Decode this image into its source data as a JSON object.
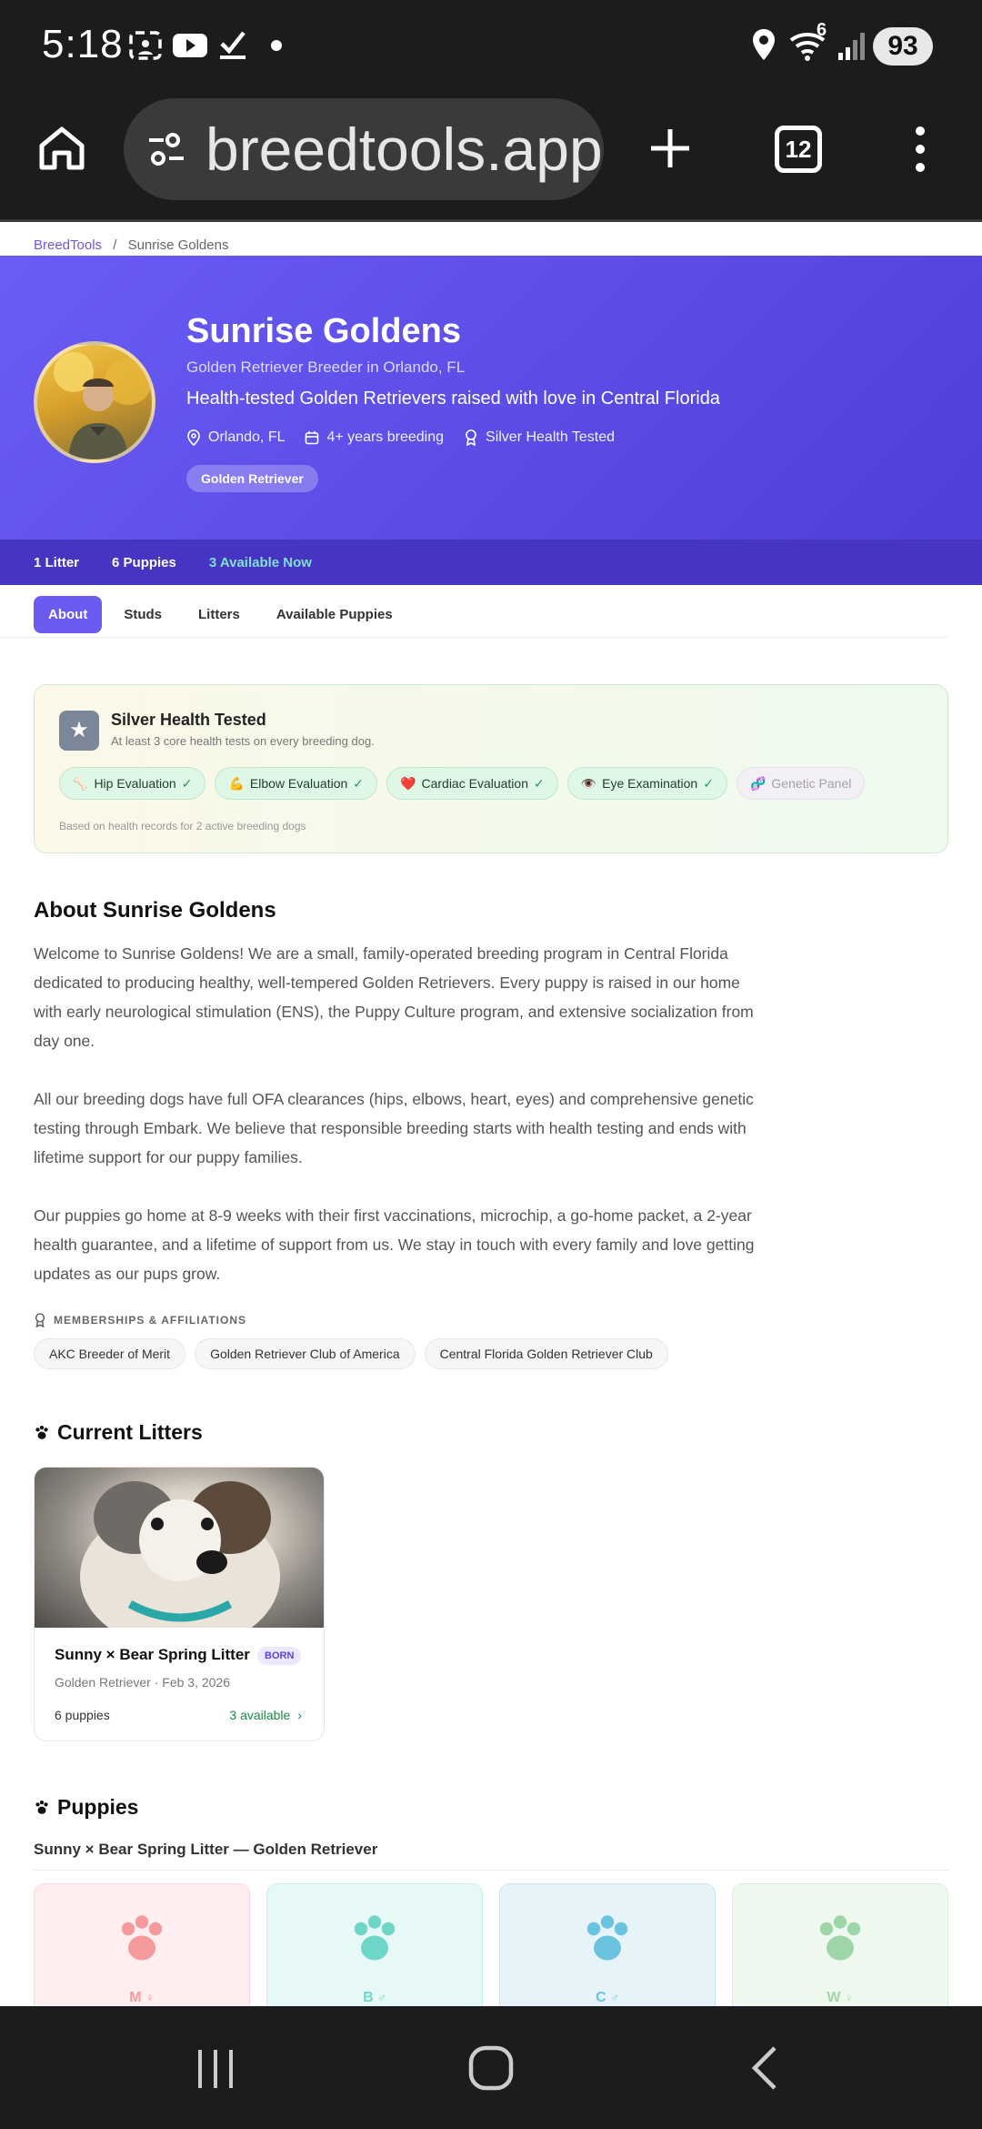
{
  "status": {
    "time": "5:18",
    "battery": "93",
    "signal_sup": "6"
  },
  "browser": {
    "url": "breedtools.app/",
    "tab_count": "12"
  },
  "breadcrumb": {
    "home": "BreedTools",
    "sep": "/",
    "current": "Sunrise Goldens"
  },
  "hero": {
    "title": "Sunrise Goldens",
    "subtitle": "Golden Retriever Breeder in Orlando, FL",
    "tagline": "Health-tested Golden Retrievers raised with love in Central Florida",
    "location": "Orlando, FL",
    "experience": "4+ years breeding",
    "health": "Silver Health Tested",
    "breed_badge": "Golden Retriever"
  },
  "stats": {
    "litters": "1 Litter",
    "puppies": "6 Puppies",
    "available": "3 Available Now"
  },
  "tabs": [
    "About",
    "Studs",
    "Litters",
    "Available Puppies"
  ],
  "health_card": {
    "title": "Silver Health Tested",
    "subtitle": "At least 3 core health tests on every breeding dog.",
    "chips": [
      {
        "emoji": "🦴",
        "label": "Hip Evaluation",
        "done": true
      },
      {
        "emoji": "💪",
        "label": "Elbow Evaluation",
        "done": true
      },
      {
        "emoji": "❤️",
        "label": "Cardiac Evaluation",
        "done": true
      },
      {
        "emoji": "👁️",
        "label": "Eye Examination",
        "done": true
      },
      {
        "emoji": "🧬",
        "label": "Genetic Panel",
        "done": false
      }
    ],
    "note": "Based on health records for 2 active breeding dogs"
  },
  "about": {
    "title": "About Sunrise Goldens",
    "p1": "Welcome to Sunrise Goldens! We are a small, family-operated breeding program in Central Florida dedicated to producing healthy, well-tempered Golden Retrievers. Every puppy is raised in our home with early neurological stimulation (ENS), the Puppy Culture program, and extensive socialization from day one.",
    "p2": "All our breeding dogs have full OFA clearances (hips, elbows, heart, eyes) and comprehensive genetic testing through Embark. We believe that responsible breeding starts with health testing and ends with lifetime support for our puppy families.",
    "p3": "Our puppies go home at 8-9 weeks with their first vaccinations, microchip, a go-home packet, a 2-year health guarantee, and a lifetime of support from us. We stay in touch with every family and love getting updates as our pups grow."
  },
  "memberships": {
    "label": "MEMBERSHIPS & AFFILIATIONS",
    "items": [
      "AKC Breeder of Merit",
      "Golden Retriever Club of America",
      "Central Florida Golden Retriever Club"
    ]
  },
  "litters": {
    "title": "Current Litters",
    "card": {
      "name": "Sunny × Bear Spring Litter",
      "badge": "BORN",
      "meta": "Golden Retriever · Feb 3, 2026",
      "count": "6 puppies",
      "available": "3 available"
    }
  },
  "puppies": {
    "title": "Puppies",
    "subtitle": "Sunny × Bear Spring Litter — Golden Retriever",
    "cards": [
      {
        "letter": "M",
        "sex": "♀",
        "color": "#f49a9a"
      },
      {
        "letter": "B",
        "sex": "♂",
        "color": "#6ed6c6"
      },
      {
        "letter": "C",
        "sex": "♂",
        "color": "#6cc3e0"
      },
      {
        "letter": "W",
        "sex": "♀",
        "color": "#9fd6a9"
      }
    ]
  }
}
